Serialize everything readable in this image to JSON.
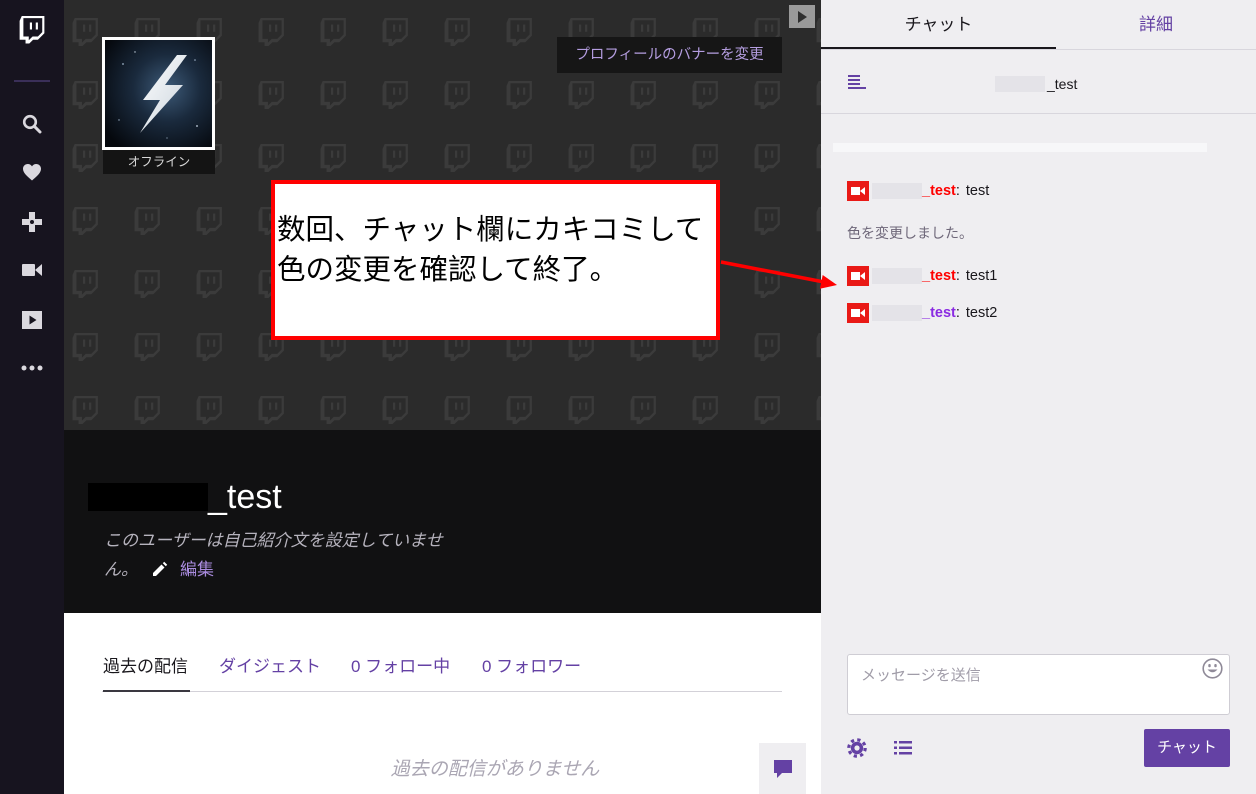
{
  "colors": {
    "sidebar_bg": "#17141f",
    "brand_purple": "#6441a4",
    "broadcaster_badge": "#e91916",
    "annotation_red": "#ff0000"
  },
  "sidebar": {
    "logo_icon": "twitch-glitch-icon",
    "items": [
      {
        "icon": "search-icon"
      },
      {
        "icon": "heart-icon"
      },
      {
        "icon": "gamepad-icon"
      },
      {
        "icon": "video-camera-icon"
      },
      {
        "icon": "play-icon"
      },
      {
        "icon": "more-dots-icon"
      }
    ]
  },
  "banner": {
    "change_banner_label": "プロフィールのバナーを変更",
    "status_label": "オフライン"
  },
  "profile": {
    "username": "_test",
    "bio": "このユーザーは自己紹介文を設定していません。",
    "edit_label": "編集"
  },
  "content": {
    "tabs": [
      {
        "label": "過去の配信",
        "active": true
      },
      {
        "label": "ダイジェスト",
        "active": false
      },
      {
        "label": "0 フォロー中",
        "active": false
      },
      {
        "label": "0 フォロワー",
        "active": false
      }
    ],
    "empty_message": "過去の配信がありません"
  },
  "chat": {
    "tabs": [
      {
        "label": "チャット",
        "active": true
      },
      {
        "label": "詳細",
        "active": false
      }
    ],
    "channel_name": "_test",
    "separator": ":",
    "messages": [
      {
        "badge": "broadcaster-badge-icon",
        "name": "_test",
        "name_color": "#ff0000",
        "text": "test"
      },
      {
        "text": "色を変更しました。"
      },
      {
        "badge": "broadcaster-badge-icon",
        "name": "_test",
        "name_color": "#ff0000",
        "text": "test1"
      },
      {
        "badge": "broadcaster-badge-icon",
        "name": "_test",
        "name_color": "#8a2be2",
        "text": "test2"
      }
    ],
    "input_placeholder": "メッセージを送信",
    "send_label": "チャット"
  },
  "annotation": {
    "lines": [
      "数回、チャット欄にカキコミして",
      "色の変更を確認して終了。"
    ]
  }
}
